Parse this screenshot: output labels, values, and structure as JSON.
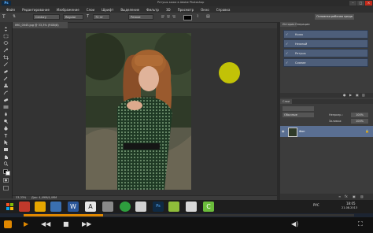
{
  "window": {
    "logo_text": "Ps",
    "doc_title": "Ретушь кожи в Adobe Photoshop"
  },
  "menu": [
    "Файл",
    "Редактирование",
    "Изображение",
    "Слои",
    "Шрифт",
    "Выделение",
    "Фильтр",
    "3D",
    "Просмотр",
    "Окно",
    "Справка"
  ],
  "options": {
    "font_family": "Century",
    "font_style": "Regular",
    "font_size": "72 пт",
    "antialias": "Резкое",
    "workspace": "Основная рабочая среда"
  },
  "document": {
    "tab_label": "IMG_0045.jpg @ 33,3% (RGB/8)",
    "zoom": "33,33%",
    "doc_info": "Док: 4,49M/4,49M"
  },
  "actions_panel": {
    "tabs": [
      "История",
      "Операции"
    ],
    "rows": [
      "Кожа",
      "Нежный",
      "Ретушь",
      "Сияние"
    ]
  },
  "layers_panel": {
    "tab": "Слои",
    "blend_mode": "Обычные",
    "opacity_label": "Непрозр.:",
    "opacity_value": "100%",
    "fill_label": "Заливка:",
    "fill_value": "100%",
    "layer_name": "Фон"
  },
  "taskbar": {
    "language": "РУС",
    "time": "18:05",
    "date": "21.08.2013"
  },
  "media": {
    "progress": 0.24
  },
  "colors": {
    "accent": "#e08800",
    "cursor_highlight": "#dcdc00",
    "panel_selected": "#5a6f92"
  }
}
